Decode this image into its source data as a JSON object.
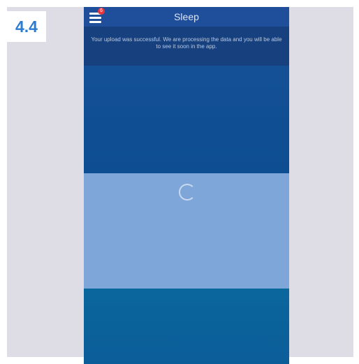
{
  "step_label": "4.4",
  "app": {
    "title": "Sleep",
    "menu_badge": "6",
    "upload_message": "Your upload was successful. We are processing the data and you will be able to see it soon in the app."
  },
  "icons": {
    "menu": "hamburger-menu-icon",
    "loading": "loading-spinner-icon"
  },
  "colors": {
    "header": "#1f4e9a",
    "notice_banner": "#17407f",
    "loading_panel": "#7fa6d9",
    "badge": "#e8363f",
    "step_label_text": "#2c7dd0"
  }
}
